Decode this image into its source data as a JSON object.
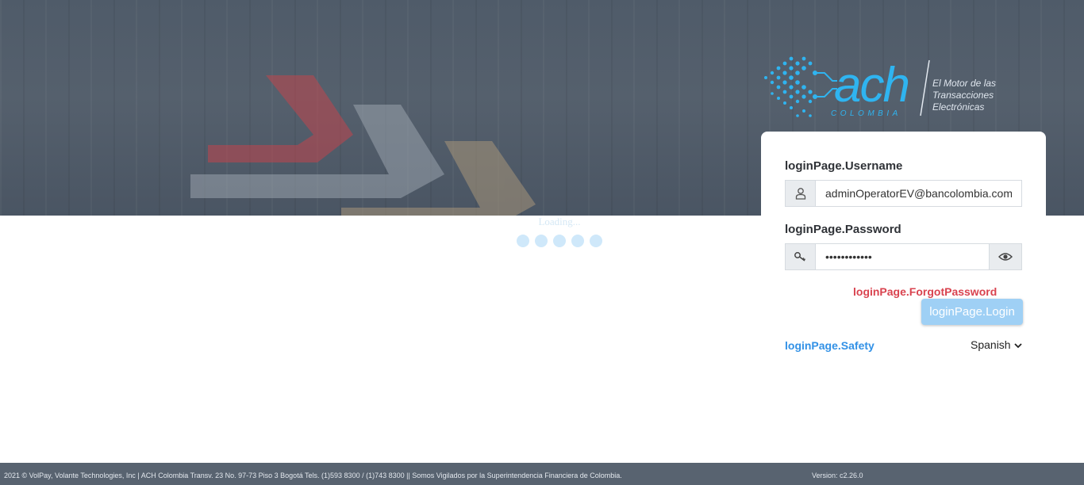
{
  "brand": {
    "name": "ach",
    "country": "COLOMBIA",
    "tagline": [
      "El Motor de las",
      "Transacciones",
      "Electrónicas"
    ]
  },
  "loading": {
    "text": "Loading..."
  },
  "login": {
    "username_label": "loginPage.Username",
    "username_value": "adminOperatorEV@bancolombia.com",
    "password_label": "loginPage.Password",
    "password_value": "••••••••••••",
    "forgot_password": "loginPage.ForgotPassword",
    "login_button": "loginPage.Login",
    "safety_link": "loginPage.Safety",
    "language": "Spanish"
  },
  "footer": {
    "copyright": "2021 © VolPay, Volante Technologies, Inc | ACH Colombia Transv. 23 No. 97-73 Piso 3 Bogotá Tels. (1)593 8300 / (1)743 8300 || Somos Vigilados por la Superintendencia Financiera de Colombia.",
    "version": "Version: c2.26.0"
  },
  "icons": {
    "user": "user-icon",
    "key": "key-icon",
    "eye": "eye-icon",
    "chevron": "chevron-down-icon"
  },
  "colors": {
    "brand_blue": "#2fb4f0",
    "link_red": "#d9434f",
    "link_blue": "#3291e6",
    "button": "#9fd0f5",
    "footer_bg": "#586370"
  }
}
